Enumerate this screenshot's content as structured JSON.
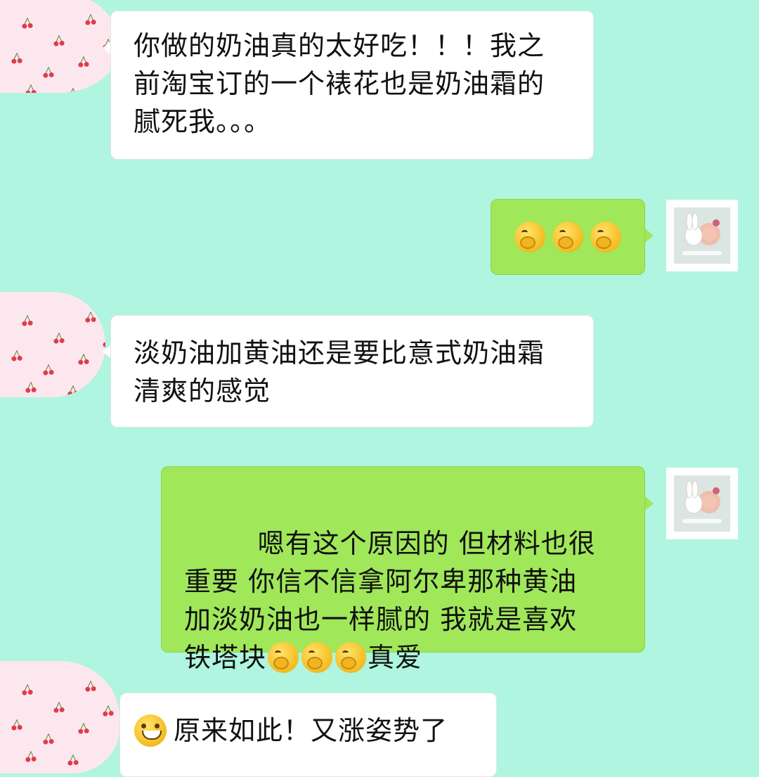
{
  "messages": [
    {
      "side": "left",
      "text": "你做的奶油真的太好吃！！！我之前淘宝订的一个裱花也是奶油霜的腻死我。。。"
    },
    {
      "side": "right",
      "emojis": [
        "hug-face",
        "hug-face",
        "hug-face"
      ]
    },
    {
      "side": "left",
      "text": "淡奶油加黄油还是要比意式奶油霜清爽的感觉"
    },
    {
      "side": "right",
      "text_before": "嗯有这个原因的 但材料也很重要 你信不信拿阿尔卑那种黄油加淡奶油也一样腻的 我就是喜欢铁塔块",
      "emojis": [
        "hug-face",
        "hug-face",
        "hug-face"
      ],
      "text_after": "真爱"
    },
    {
      "side": "left",
      "emoji": "grinning-face",
      "text": "原来如此！又涨姿势了"
    }
  ],
  "colors": {
    "background": "#aff5e0",
    "bubble_left": "#ffffff",
    "bubble_right": "#a0e75a",
    "avatar_left_bg": "#fde7ef",
    "cherry_red": "#e23b4a"
  },
  "icons": {
    "left_avatar": "cherry-pattern-avatar",
    "right_avatar": "bunny-shop-logo-avatar"
  }
}
